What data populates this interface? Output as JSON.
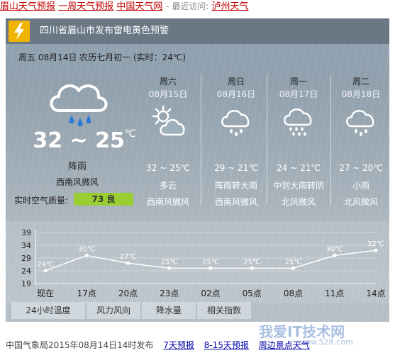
{
  "topbar": {
    "links": [
      "眉山天气预报",
      "一周天气预报",
      "中国天气网"
    ],
    "separator": "-",
    "recent_label": "最近访问:",
    "recent_link": "泸州天气"
  },
  "alert": {
    "text": "四川省眉山市发布雷电黄色预警",
    "color": "#f0b400",
    "icon": "lightning-icon"
  },
  "today": {
    "date_line": "周五 08月14日 农历七月初一 (实时：24℃)",
    "temp": "32 ~ 25",
    "unit": "℃",
    "desc": "阵雨",
    "wind": "西南风微风",
    "aqi_label": "实时空气质量:",
    "aqi_value": "73 良",
    "aqi_color": "#9acd32",
    "icon": "cloud-rain-icon"
  },
  "forecast": [
    {
      "day": "周六",
      "date": "08月15日",
      "temp": "32 ~ 25℃",
      "desc": "多云",
      "wind": "西南风微风",
      "icon": "partly-cloudy-icon"
    },
    {
      "day": "周日",
      "date": "08月16日",
      "temp": "29 ~ 21℃",
      "desc": "阵雨转大雨",
      "wind": "西南风微风",
      "icon": "cloud-rain-icon"
    },
    {
      "day": "周一",
      "date": "08月17日",
      "temp": "24 ~ 21℃",
      "desc": "中到大雨转阴",
      "wind": "北风微风",
      "icon": "cloud-heavy-rain-icon"
    },
    {
      "day": "周二",
      "date": "08月18日",
      "temp": "27 ~ 20℃",
      "desc": "小雨",
      "wind": "北风微风",
      "icon": "cloud-rain-icon"
    }
  ],
  "chart_data": {
    "type": "line",
    "categories": [
      "现在",
      "17点",
      "20点",
      "23点",
      "02点",
      "05点",
      "08点",
      "11点",
      "14点"
    ],
    "values": [
      24,
      30,
      27,
      25,
      25,
      25,
      25,
      30,
      32
    ],
    "data_labels": [
      "24℃",
      "30℃",
      "27℃",
      "25℃",
      "25℃",
      "25℃",
      "25℃",
      "30℃",
      "32℃"
    ],
    "y_ticks": [
      39,
      34,
      29,
      24,
      19
    ],
    "ylim": [
      19,
      39
    ],
    "grid": true
  },
  "tabs": [
    "24小时温度",
    "风力风向",
    "降水量",
    "相关指数"
  ],
  "footer": {
    "text": "中国气象局2015年08月14日14时发布",
    "links": [
      "7天预报",
      "8-15天预报",
      "周边景点天气"
    ]
  },
  "watermark": {
    "text": "我爱IT技术网",
    "sub": "www.52lt.com"
  }
}
